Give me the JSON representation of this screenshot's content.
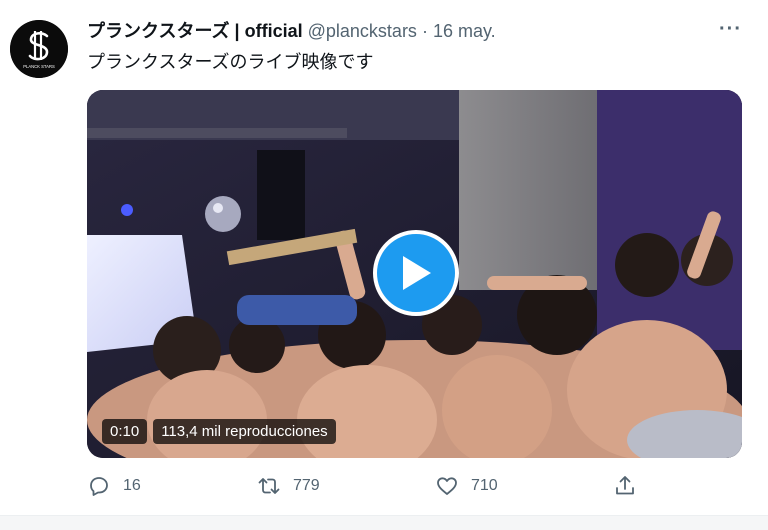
{
  "tweet": {
    "display_name": "プランクスターズ | official",
    "handle": "@planckstars",
    "separator": "·",
    "date": "16 may.",
    "more_label": "···",
    "text": "プランクスターズのライブ映像です"
  },
  "avatar": {
    "logo_text": "PLANCK STARS",
    "icon": "planckstars-logo"
  },
  "video": {
    "duration": "0:10",
    "views": "113,4 mil reproducciones",
    "play_icon": "play-icon",
    "accent_color": "#1d9bf0"
  },
  "actions": {
    "reply_count": "16",
    "retweet_count": "779",
    "like_count": "710",
    "reply_icon": "reply-icon",
    "retweet_icon": "retweet-icon",
    "like_icon": "heart-icon",
    "share_icon": "share-icon"
  }
}
